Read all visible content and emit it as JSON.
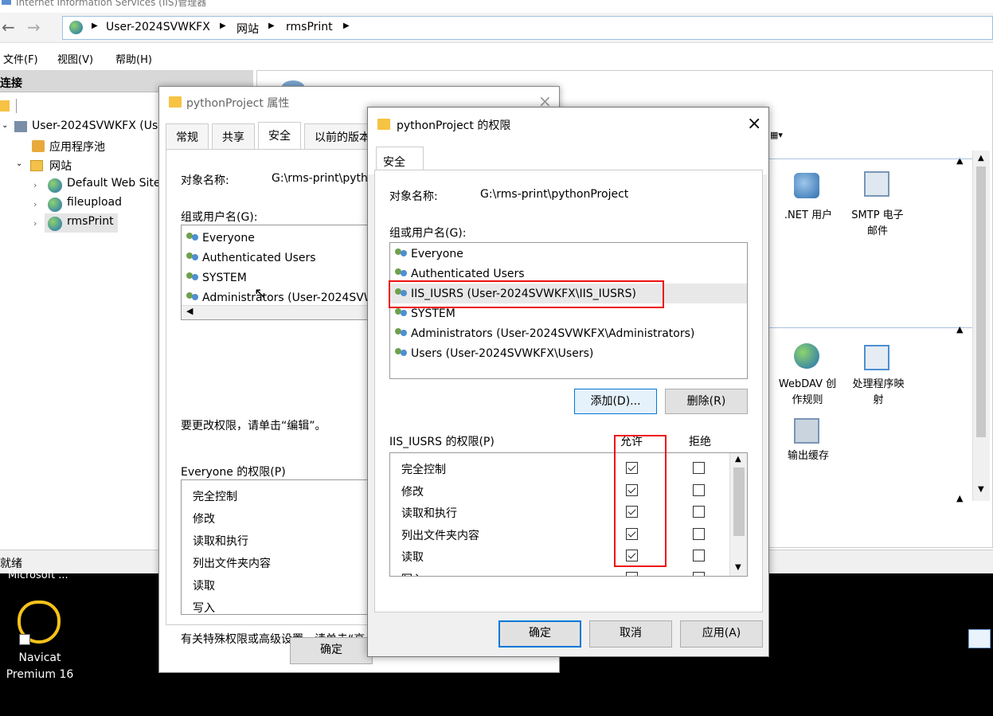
{
  "iis": {
    "title": "Internet Information Services (IIS)管理器",
    "breadcrumb": [
      "User-2024SVWKFX",
      "网站",
      "rmsPrint"
    ],
    "menu": [
      "文件(F)",
      "视图(V)",
      "帮助(H)"
    ],
    "left_header": "连接",
    "tree": {
      "server": "User-2024SVWKFX (Us",
      "app_pools": "应用程序池",
      "sites": "网站",
      "site_items": [
        "Default Web Site",
        "fileupload",
        "rmsPrint"
      ]
    },
    "features": {
      "net_users": ".NET 用户",
      "smtp": "SMTP 电子\n邮件",
      "webdav": "WebDAV 创\n作规则",
      "handler": "处理程序映\n射",
      "output_cache": "输出缓存"
    },
    "status": "就绪"
  },
  "desktop": {
    "icon1_label": "Microsoft ...",
    "navicat_label": "Navicat\nPremium 16"
  },
  "props": {
    "title": "pythonProject 属性",
    "tabs": [
      "常规",
      "共享",
      "安全",
      "以前的版本"
    ],
    "object_label": "对象名称:",
    "object_value": "G:\\rms-print\\pyth",
    "group_label": "组或用户名(G):",
    "users": [
      "Everyone",
      "Authenticated Users",
      "SYSTEM",
      "Administrators (User-2024SVW"
    ],
    "edit_hint": "要更改权限，请单击“编辑”。",
    "perm_label": "Everyone 的权限(P)",
    "perms": [
      "完全控制",
      "修改",
      "读取和执行",
      "列出文件夹内容",
      "读取",
      "写入"
    ],
    "advanced_hint": "有关特殊权限或高级设置，请单击“高",
    "ok": "确定"
  },
  "perm": {
    "title": "pythonProject 的权限",
    "tab": "安全",
    "object_label": "对象名称:",
    "object_value": "G:\\rms-print\\pythonProject",
    "group_label": "组或用户名(G):",
    "users": [
      "Everyone",
      "Authenticated Users",
      "IIS_IUSRS (User-2024SVWKFX\\IIS_IUSRS)",
      "SYSTEM",
      "Administrators (User-2024SVWKFX\\Administrators)",
      "Users (User-2024SVWKFX\\Users)"
    ],
    "add": "添加(D)...",
    "remove": "删除(R)",
    "perm_label": "IIS_IUSRS 的权限(P)",
    "allow": "允许",
    "deny": "拒绝",
    "perms": [
      "完全控制",
      "修改",
      "读取和执行",
      "列出文件夹内容",
      "读取",
      "写入"
    ],
    "allow_checked": [
      true,
      true,
      true,
      true,
      true,
      true
    ],
    "deny_checked": [
      false,
      false,
      false,
      false,
      false,
      false
    ],
    "ok": "确定",
    "cancel": "取消",
    "apply": "应用(A)"
  }
}
